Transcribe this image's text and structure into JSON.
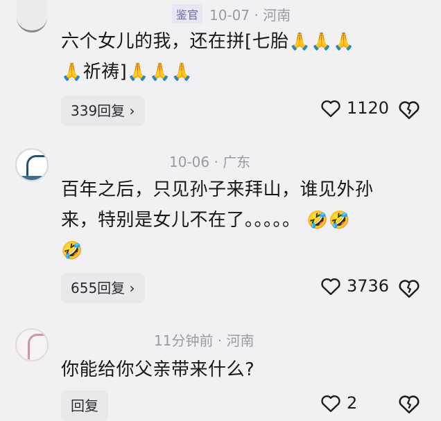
{
  "comments": [
    {
      "badge": "鉴官",
      "meta": "10-07 · 河南",
      "line1": "六个女儿的我，还在拼[七胎",
      "line2_text": "祈祷]",
      "emoji_pray": "🙏",
      "reply_label": "339回复",
      "likes": "1120"
    },
    {
      "meta": "10-06 · 广东",
      "line1": "百年之后，只见孙子来拜山，谁见外孙",
      "line2": "来，特别是女儿不在了。。。。。",
      "emoji_laugh": "🤣",
      "reply_label": "655回复",
      "likes": "3736"
    },
    {
      "meta": "11分钟前 · 河南",
      "line1": "你能给你父亲带来什么?",
      "reply_label": "回复",
      "likes": "2"
    }
  ],
  "icons": {
    "chevron": "›",
    "like": "heart-outline-icon",
    "dislike": "broken-heart-icon"
  },
  "colors": {
    "background": "#f1f1f3",
    "meta_gray": "#9a9aa2",
    "badge_bg": "#e7e6f5",
    "badge_text": "#6b66b9"
  }
}
